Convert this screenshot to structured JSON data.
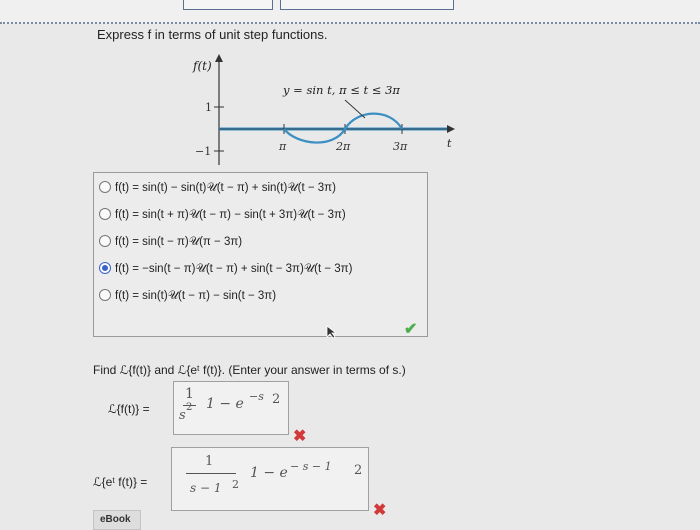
{
  "prompt": "Express f in terms of unit step functions.",
  "graph": {
    "ylabel": "f(t)",
    "xlabel": "t",
    "curve_label": "y = sin t,  π ≤ t ≤ 3π",
    "yticks": [
      "1",
      "−1"
    ],
    "xticks": [
      "π",
      "2π",
      "3π"
    ]
  },
  "choices": [
    {
      "text": "f(t) = sin(t) − sin(t)𝒰(t − π) + sin(t)𝒰(t − 3π)",
      "selected": false
    },
    {
      "text": "f(t) = sin(t + π)𝒰(t − π) − sin(t + 3π)𝒰(t − 3π)",
      "selected": false
    },
    {
      "text": "f(t) = sin(t − π)𝒰(π − 3π)",
      "selected": false
    },
    {
      "text": "f(t) = −sin(t − π)𝒰(t − π) + sin(t − 3π)𝒰(t − 3π)",
      "selected": true
    },
    {
      "text": "f(t) = sin(t)𝒰(t − π) − sin(t − 3π)",
      "selected": false
    }
  ],
  "find_text": "Find ℒ{f(t)} and ℒ{eᵗ f(t)}. (Enter your answer in terms of s.)",
  "answer1": {
    "label": "ℒ{f(t)}  =",
    "num": "1",
    "den": "s",
    "den_exp": "2",
    "rest": "1 − e",
    "exp": "−s",
    "tail": "2"
  },
  "answer2": {
    "label": "ℒ{eᵗ f(t)}  =",
    "num": "1",
    "den": "s − 1",
    "den_exp": "2",
    "rest": "1 − e",
    "exp": "−  s − 1",
    "tail": "2"
  },
  "ebook": "eBook",
  "colors": {
    "curve": "#3b8fc2",
    "check": "#4cae4c",
    "cross": "#d23a3a",
    "radio": "#3b64c9"
  }
}
